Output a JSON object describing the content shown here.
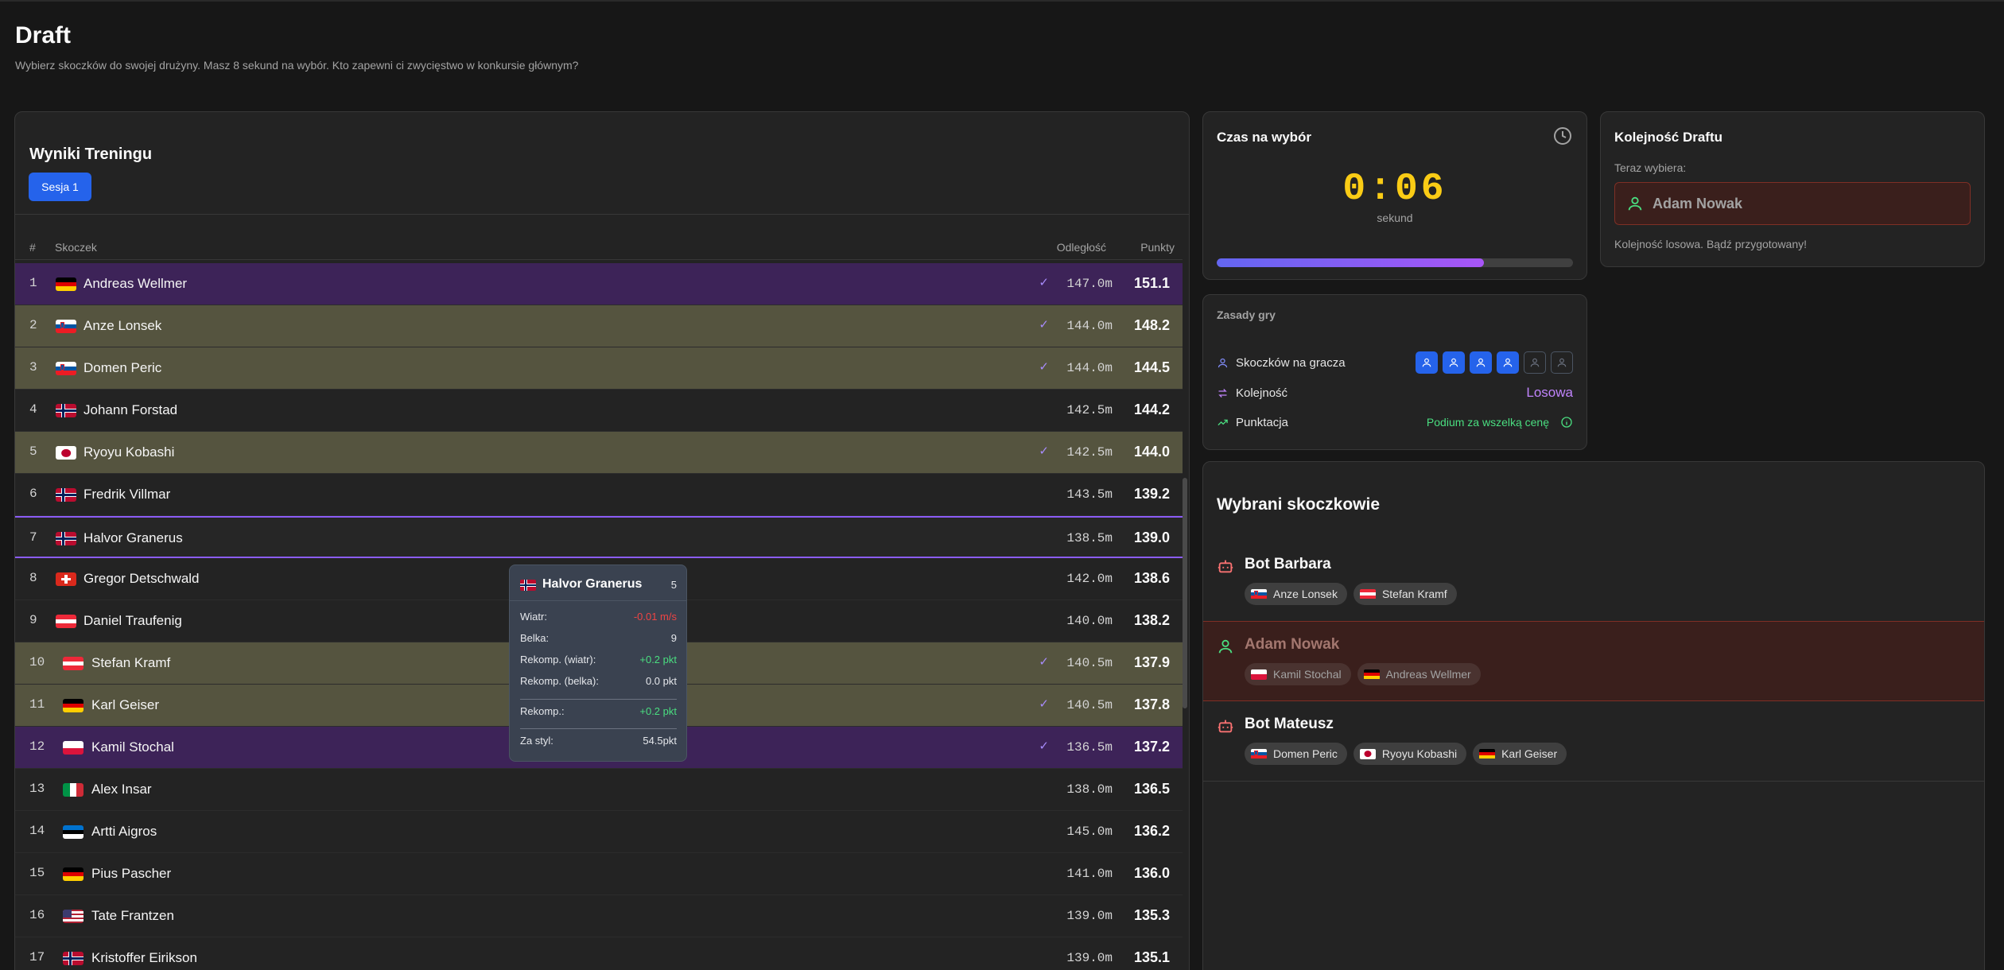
{
  "header": {
    "title": "Draft",
    "subtitle": "Wybierz skoczków do swojej drużyny. Masz 8 sekund na wybór. Kto zapewni ci zwycięstwo w konkursie głównym?"
  },
  "results": {
    "title": "Wyniki Treningu",
    "session_label": "Sesja 1",
    "columns": {
      "num": "#",
      "name": "Skoczek",
      "distance": "Odległość",
      "points": "Punkty"
    },
    "rows": [
      {
        "num": "1",
        "name": "Andreas Wellmer",
        "flag": "GER",
        "distance": "147.0m",
        "points": "151.1",
        "picked": true
      },
      {
        "num": "2",
        "name": "Anze Lonsek",
        "flag": "SLO",
        "distance": "144.0m",
        "points": "148.2",
        "picked": true
      },
      {
        "num": "3",
        "name": "Domen Peric",
        "flag": "SLO",
        "distance": "144.0m",
        "points": "144.5",
        "picked": true
      },
      {
        "num": "4",
        "name": "Johann Forstad",
        "flag": "NOR",
        "distance": "142.5m",
        "points": "144.2",
        "picked": false
      },
      {
        "num": "5",
        "name": "Ryoyu Kobashi",
        "flag": "JPN",
        "distance": "142.5m",
        "points": "144.0",
        "picked": true
      },
      {
        "num": "6",
        "name": "Fredrik Villmar",
        "flag": "NOR",
        "distance": "143.5m",
        "points": "139.2",
        "picked": false
      },
      {
        "num": "7",
        "name": "Halvor Granerus",
        "flag": "NOR",
        "distance": "138.5m",
        "points": "139.0",
        "picked": false
      },
      {
        "num": "8",
        "name": "Gregor Detschwald",
        "flag": "SUI",
        "distance": "142.0m",
        "points": "138.6",
        "picked": false
      },
      {
        "num": "9",
        "name": "Daniel Traufenig",
        "flag": "AUT",
        "distance": "140.0m",
        "points": "138.2",
        "picked": false
      },
      {
        "num": "10",
        "name": "Stefan Kramf",
        "flag": "AUT",
        "distance": "140.5m",
        "points": "137.9",
        "picked": true
      },
      {
        "num": "11",
        "name": "Karl Geiser",
        "flag": "GER",
        "distance": "140.5m",
        "points": "137.8",
        "picked": true
      },
      {
        "num": "12",
        "name": "Kamil Stochal",
        "flag": "POL",
        "distance": "136.5m",
        "points": "137.2",
        "picked": true
      },
      {
        "num": "13",
        "name": "Alex Insar",
        "flag": "ITA",
        "distance": "138.0m",
        "points": "136.5",
        "picked": false
      },
      {
        "num": "14",
        "name": "Artti Aigros",
        "flag": "EST",
        "distance": "145.0m",
        "points": "136.2",
        "picked": false
      },
      {
        "num": "15",
        "name": "Pius Pascher",
        "flag": "GER",
        "distance": "141.0m",
        "points": "136.0",
        "picked": false
      },
      {
        "num": "16",
        "name": "Tate Frantzen",
        "flag": "USA",
        "distance": "139.0m",
        "points": "135.3",
        "picked": false
      },
      {
        "num": "17",
        "name": "Kristoffer Eirikson",
        "flag": "NOR",
        "distance": "139.0m",
        "points": "135.1",
        "picked": false
      }
    ],
    "check_icon": "check-icon"
  },
  "tooltip": {
    "name": "Halvor Granerus",
    "flag": "NOR",
    "rank": "5",
    "wind_label": "Wiatr:",
    "wind_value": "-0.01 m/s",
    "gate_label": "Belka:",
    "gate_value": "9",
    "wind_comp_label": "Rekomp. (wiatr):",
    "wind_comp_value": "+0.2 pkt",
    "gate_comp_label": "Rekomp. (belka):",
    "gate_comp_value": "0.0 pkt",
    "total_comp_label": "Rekomp.:",
    "total_comp_value": "+0.2 pkt",
    "style_label": "Za styl:",
    "style_value": "54.5pkt"
  },
  "timer": {
    "title": "Czas na wybór",
    "value": "0:06",
    "unit": "sekund",
    "progress_percent": 75,
    "icon": "clock-icon"
  },
  "rules": {
    "title": "Zasady gry",
    "jumpers_label": "Skoczków na gracza",
    "jumpers_per_player": 6,
    "jumpers_filled": 4,
    "order_label": "Kolejność",
    "order_value": "Losowa",
    "scoring_label": "Punktacja",
    "scoring_value": "Podium za wszelką cenę"
  },
  "draft_order": {
    "title": "Kolejność Draftu",
    "now_picking_label": "Teraz wybiera:",
    "current_player": "Adam Nowak",
    "note": "Kolejność losowa. Bądź przygotowany!"
  },
  "selected": {
    "title": "Wybrani skoczkowie",
    "teams": [
      {
        "name": "Bot Barbara",
        "type": "bot",
        "picks": [
          {
            "name": "Anze Lonsek",
            "flag": "SLO"
          },
          {
            "name": "Stefan Kramf",
            "flag": "AUT"
          }
        ]
      },
      {
        "name": "Adam Nowak",
        "type": "user",
        "picks": [
          {
            "name": "Kamil Stochal",
            "flag": "POL"
          },
          {
            "name": "Andreas Wellmer",
            "flag": "GER"
          }
        ]
      },
      {
        "name": "Bot Mateusz",
        "type": "bot",
        "picks": [
          {
            "name": "Domen Peric",
            "flag": "SLO"
          },
          {
            "name": "Ryoyu Kobashi",
            "flag": "JPN"
          },
          {
            "name": "Karl Geiser",
            "flag": "GER"
          }
        ]
      }
    ]
  },
  "colors": {
    "accent": "#2563eb",
    "purple": "#8b5cf6",
    "timer": "#facc15",
    "positive": "#4ade80",
    "negative": "#ef4444"
  }
}
